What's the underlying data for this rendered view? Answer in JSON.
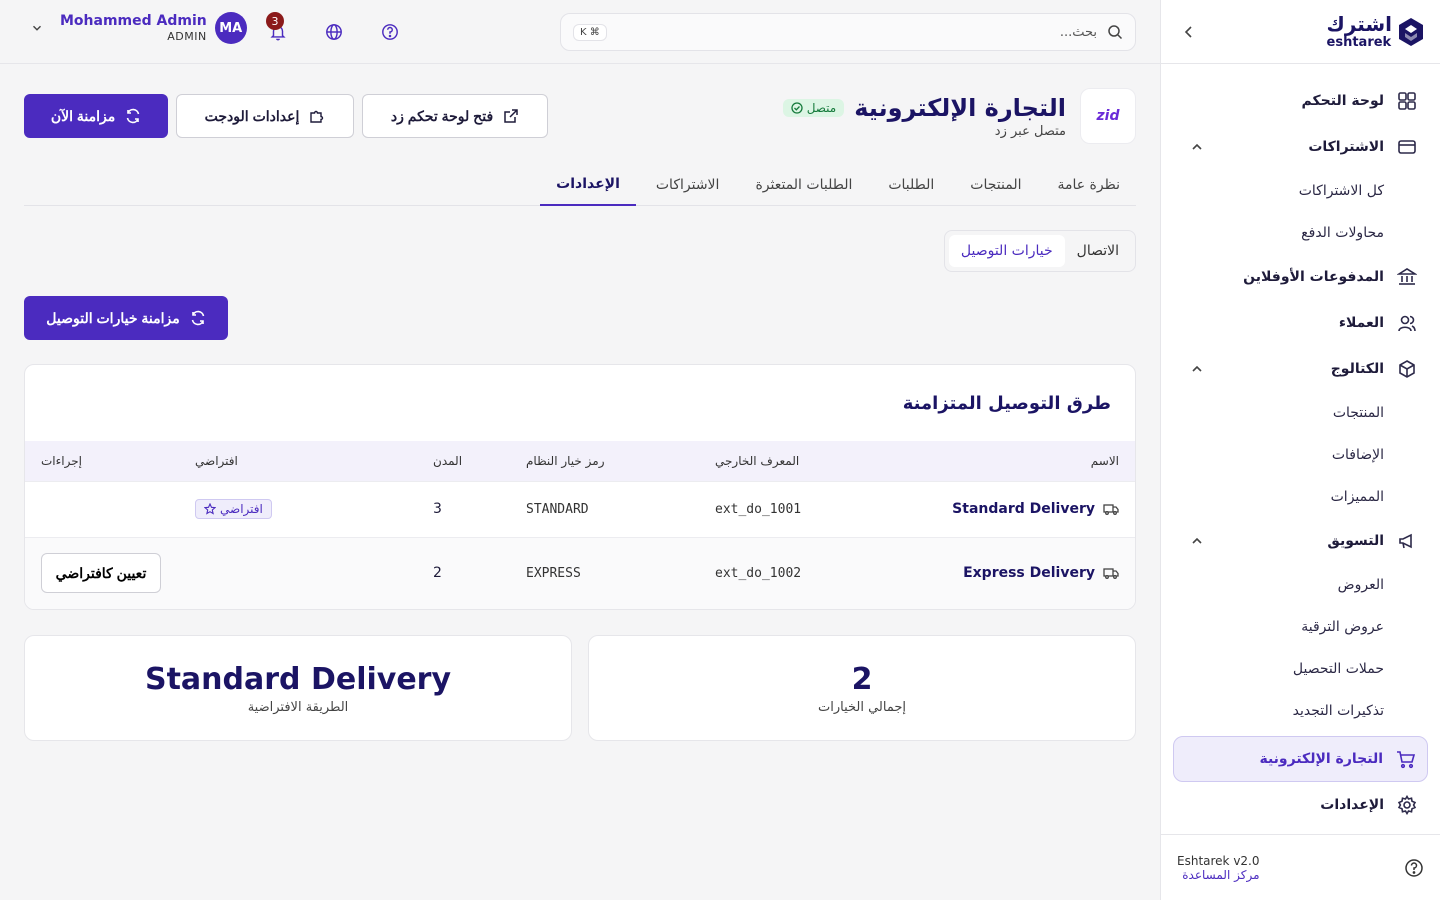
{
  "brand": {
    "name_ar": "اشترك",
    "name_en": "eshtarek"
  },
  "sidebar": {
    "items": [
      {
        "label": "لوحة التحكم"
      },
      {
        "label": "الاشتراكات"
      },
      {
        "label": "كل الاشتراكات"
      },
      {
        "label": "محاولات الدفع"
      },
      {
        "label": "المدفوعات الأوفلاين"
      },
      {
        "label": "العملاء"
      },
      {
        "label": "الكتالوج"
      },
      {
        "label": "المنتجات"
      },
      {
        "label": "الإضافات"
      },
      {
        "label": "المميزات"
      },
      {
        "label": "التسويق"
      },
      {
        "label": "العروض"
      },
      {
        "label": "عروض الترقية"
      },
      {
        "label": "حملات التحصيل"
      },
      {
        "label": "تذكيرات التجديد"
      },
      {
        "label": "التجارة الإلكترونية"
      },
      {
        "label": "الإعدادات"
      }
    ],
    "footer": {
      "version": "Eshtarek v2.0",
      "help": "مركز المساعدة"
    }
  },
  "topbar": {
    "search_placeholder": "بحث...",
    "shortcut": "⌘ K",
    "notifications_count": "3",
    "user": {
      "name": "Mohammed Admin",
      "role": "ADMIN",
      "initials": "MA"
    }
  },
  "header": {
    "logo_text": "zid",
    "title": "التجارة الإلكترونية",
    "status": "متصل",
    "subtitle": "متصل عبر زد",
    "actions": {
      "open_dashboard": "فتح لوحة تحكم زد",
      "widget_settings": "إعدادات الودجت",
      "sync_now": "مزامنة الآن"
    }
  },
  "tabs": [
    "نظرة عامة",
    "المنتجات",
    "الطلبات",
    "الطلبات المتعثرة",
    "الاشتراكات",
    "الإعدادات"
  ],
  "subtabs": [
    "الاتصال",
    "خيارات التوصيل"
  ],
  "sync_delivery_label": "مزامنة خيارات التوصيل",
  "table": {
    "title": "طرق التوصيل المتزامنة",
    "columns": [
      "الاسم",
      "المعرف الخارجي",
      "رمز خيار النظام",
      "المدن",
      "افتراضي",
      "إجراءات"
    ],
    "rows": [
      {
        "name": "Standard Delivery",
        "external_id": "ext_do_1001",
        "system_code": "STANDARD",
        "cities": "3",
        "default": "افتراضي",
        "action": ""
      },
      {
        "name": "Express Delivery",
        "external_id": "ext_do_1002",
        "system_code": "EXPRESS",
        "cities": "2",
        "default": "",
        "action": "تعيين كافتراضي"
      }
    ]
  },
  "stats": {
    "total": {
      "value": "2",
      "label": "إجمالي الخيارات"
    },
    "default": {
      "value": "Standard Delivery",
      "label": "الطريقة الافتراضية"
    }
  },
  "colors": {
    "primary": "#4b2bbf",
    "navy": "#1b1464",
    "success_bg": "#dcf5e4",
    "badge": "#8b1a1a"
  }
}
